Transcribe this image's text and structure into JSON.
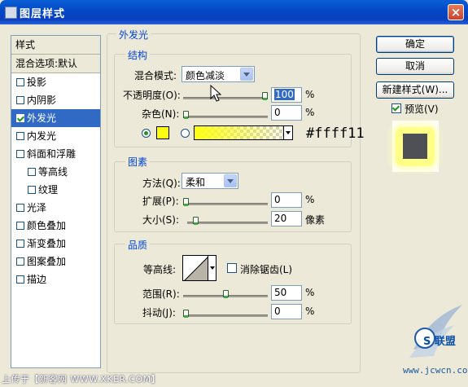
{
  "title": "图层样式",
  "close_glyph": "×",
  "left_panel": {
    "header": "样式",
    "blend_default": "混合选项:默认",
    "items": [
      {
        "label": "投影",
        "checked": false
      },
      {
        "label": "内阴影",
        "checked": false
      },
      {
        "label": "外发光",
        "checked": true,
        "selected": true
      },
      {
        "label": "内发光",
        "checked": false
      },
      {
        "label": "斜面和浮雕",
        "checked": false
      },
      {
        "label": "等高线",
        "checked": false,
        "sub": true
      },
      {
        "label": "纹理",
        "checked": false,
        "sub": true
      },
      {
        "label": "光泽",
        "checked": false
      },
      {
        "label": "颜色叠加",
        "checked": false
      },
      {
        "label": "渐变叠加",
        "checked": false
      },
      {
        "label": "图案叠加",
        "checked": false
      },
      {
        "label": "描边",
        "checked": false
      }
    ]
  },
  "outer_glow": {
    "title": "外发光",
    "structure": {
      "title": "结构",
      "blend_mode_label": "混合模式:",
      "blend_mode_value": "颜色减淡",
      "opacity_label": "不透明度(O):",
      "opacity_value": "100",
      "opacity_fraction": 1.0,
      "noise_label": "杂色(N):",
      "noise_value": "0",
      "noise_fraction": 0,
      "percent": "%",
      "color_hex": "#ffff11",
      "hex_label": "#ffff11"
    },
    "elements": {
      "title": "图素",
      "method_label": "方法(Q):",
      "method_value": "柔和",
      "spread_label": "扩展(P):",
      "spread_value": "0",
      "spread_fraction": 0,
      "size_label": "大小(S):",
      "size_value": "20",
      "size_fraction": 0.08,
      "size_unit": "像素",
      "percent": "%"
    },
    "quality": {
      "title": "品质",
      "contour_label": "等高线:",
      "antialias_label": "消除锯齿(L)",
      "antialias_checked": false,
      "range_label": "范围(R):",
      "range_value": "50",
      "range_fraction": 0.5,
      "jitter_label": "抖动(J):",
      "jitter_value": "0",
      "jitter_fraction": 0,
      "percent": "%"
    }
  },
  "buttons": {
    "ok": "确定",
    "cancel": "取消",
    "new_style": "新建样式(W)...",
    "preview_label": "预览(V)",
    "preview_checked": true
  },
  "footer": "上传于【新客网 WWW.XKER.COM】",
  "watermark": {
    "brand": "S 联盟",
    "url": "www.jcwcn.com"
  }
}
